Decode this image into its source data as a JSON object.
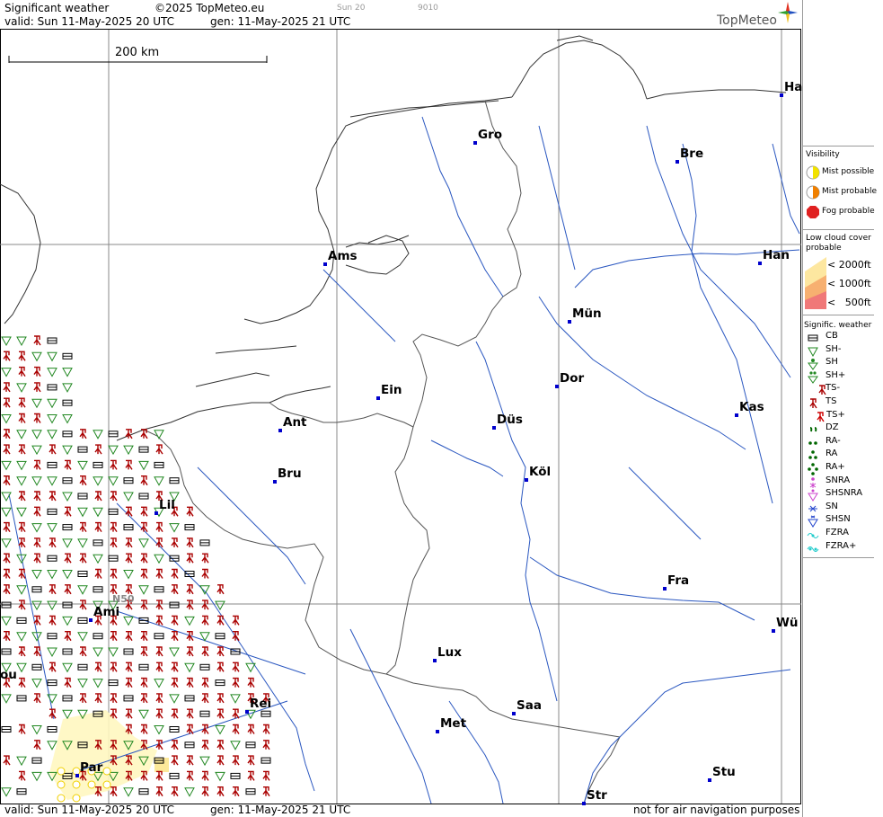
{
  "header": {
    "title": "Significant weather",
    "copyright": "©2025 TopMeteo.eu",
    "frame_label": "Sun 20",
    "code": "9010",
    "valid": "valid:  Sun  11-May-2025  20 UTC",
    "generated": "gen: 11-May-2025 21 UTC",
    "logo_text": "TopMeteo"
  },
  "scale": {
    "label": "200 km"
  },
  "grid_label": "N50",
  "cities": [
    {
      "name": "Gro"
    },
    {
      "name": "Bre"
    },
    {
      "name": "Ha"
    },
    {
      "name": "Ams"
    },
    {
      "name": "Han"
    },
    {
      "name": "Mün"
    },
    {
      "name": "Ein"
    },
    {
      "name": "Dor"
    },
    {
      "name": "Kas"
    },
    {
      "name": "Ant"
    },
    {
      "name": "Düs"
    },
    {
      "name": "Bru"
    },
    {
      "name": "Köl"
    },
    {
      "name": "Lil"
    },
    {
      "name": "Fra"
    },
    {
      "name": "Ami"
    },
    {
      "name": "Wü"
    },
    {
      "name": "Lux"
    },
    {
      "name": "ou"
    },
    {
      "name": "Rei"
    },
    {
      "name": "Saa"
    },
    {
      "name": "Met"
    },
    {
      "name": "Par"
    },
    {
      "name": "Stu"
    },
    {
      "name": "Str"
    }
  ],
  "legend": {
    "visibility_title": "Visibility",
    "visibility": [
      {
        "label": "Mist possible",
        "color": "#f2e200"
      },
      {
        "label": "Mist probable",
        "color": "#f08000"
      },
      {
        "label": "Fog probable",
        "color": "#e02020"
      }
    ],
    "low_cloud_title_1": "Low cloud cover",
    "low_cloud_title_2": "probable",
    "low_cloud": [
      {
        "label": "< 2000ft",
        "color": "#fde7a0"
      },
      {
        "label": "< 1000ft",
        "color": "#f7b070"
      },
      {
        "label": "<   500ft",
        "color": "#f07878"
      }
    ],
    "sigwx_title": "Signific. weather",
    "sigwx": [
      {
        "label": "CB",
        "icon": "cb-icon",
        "color": "#000000"
      },
      {
        "label": "SH-",
        "icon": "sh-light-icon",
        "color": "#228822"
      },
      {
        "label": "SH",
        "icon": "sh-icon",
        "color": "#228822"
      },
      {
        "label": "SH+",
        "icon": "sh-heavy-icon",
        "color": "#228822"
      },
      {
        "label": "TS-",
        "icon": "ts-light-icon",
        "color": "#aa0000"
      },
      {
        "label": "TS",
        "icon": "ts-icon",
        "color": "#aa0000"
      },
      {
        "label": "TS+",
        "icon": "ts-heavy-icon",
        "color": "#cc0000"
      },
      {
        "label": "DZ",
        "icon": "drizzle-icon",
        "color": "#006600"
      },
      {
        "label": "RA-",
        "icon": "rain-light-icon",
        "color": "#006600"
      },
      {
        "label": "RA",
        "icon": "rain-icon",
        "color": "#006600"
      },
      {
        "label": "RA+",
        "icon": "rain-heavy-icon",
        "color": "#006600"
      },
      {
        "label": "SNRA",
        "icon": "snow-rain-icon",
        "color": "#cc44cc"
      },
      {
        "label": "SHSNRA",
        "icon": "snow-rain-shower-icon",
        "color": "#cc44cc"
      },
      {
        "label": "SN",
        "icon": "snow-icon",
        "color": "#2244cc"
      },
      {
        "label": "SHSN",
        "icon": "snow-shower-icon",
        "color": "#2244cc"
      },
      {
        "label": "FZRA",
        "icon": "freezing-rain-icon",
        "color": "#22cccc"
      },
      {
        "label": "FZRA+",
        "icon": "freezing-rain-heavy-icon",
        "color": "#22cccc"
      }
    ]
  },
  "footer": {
    "valid": "valid:  Sun  11-May-2025  20 UTC",
    "generated": "gen: 11-May-2025 21 UTC",
    "disclaimer": "not for air navigation purposes"
  }
}
